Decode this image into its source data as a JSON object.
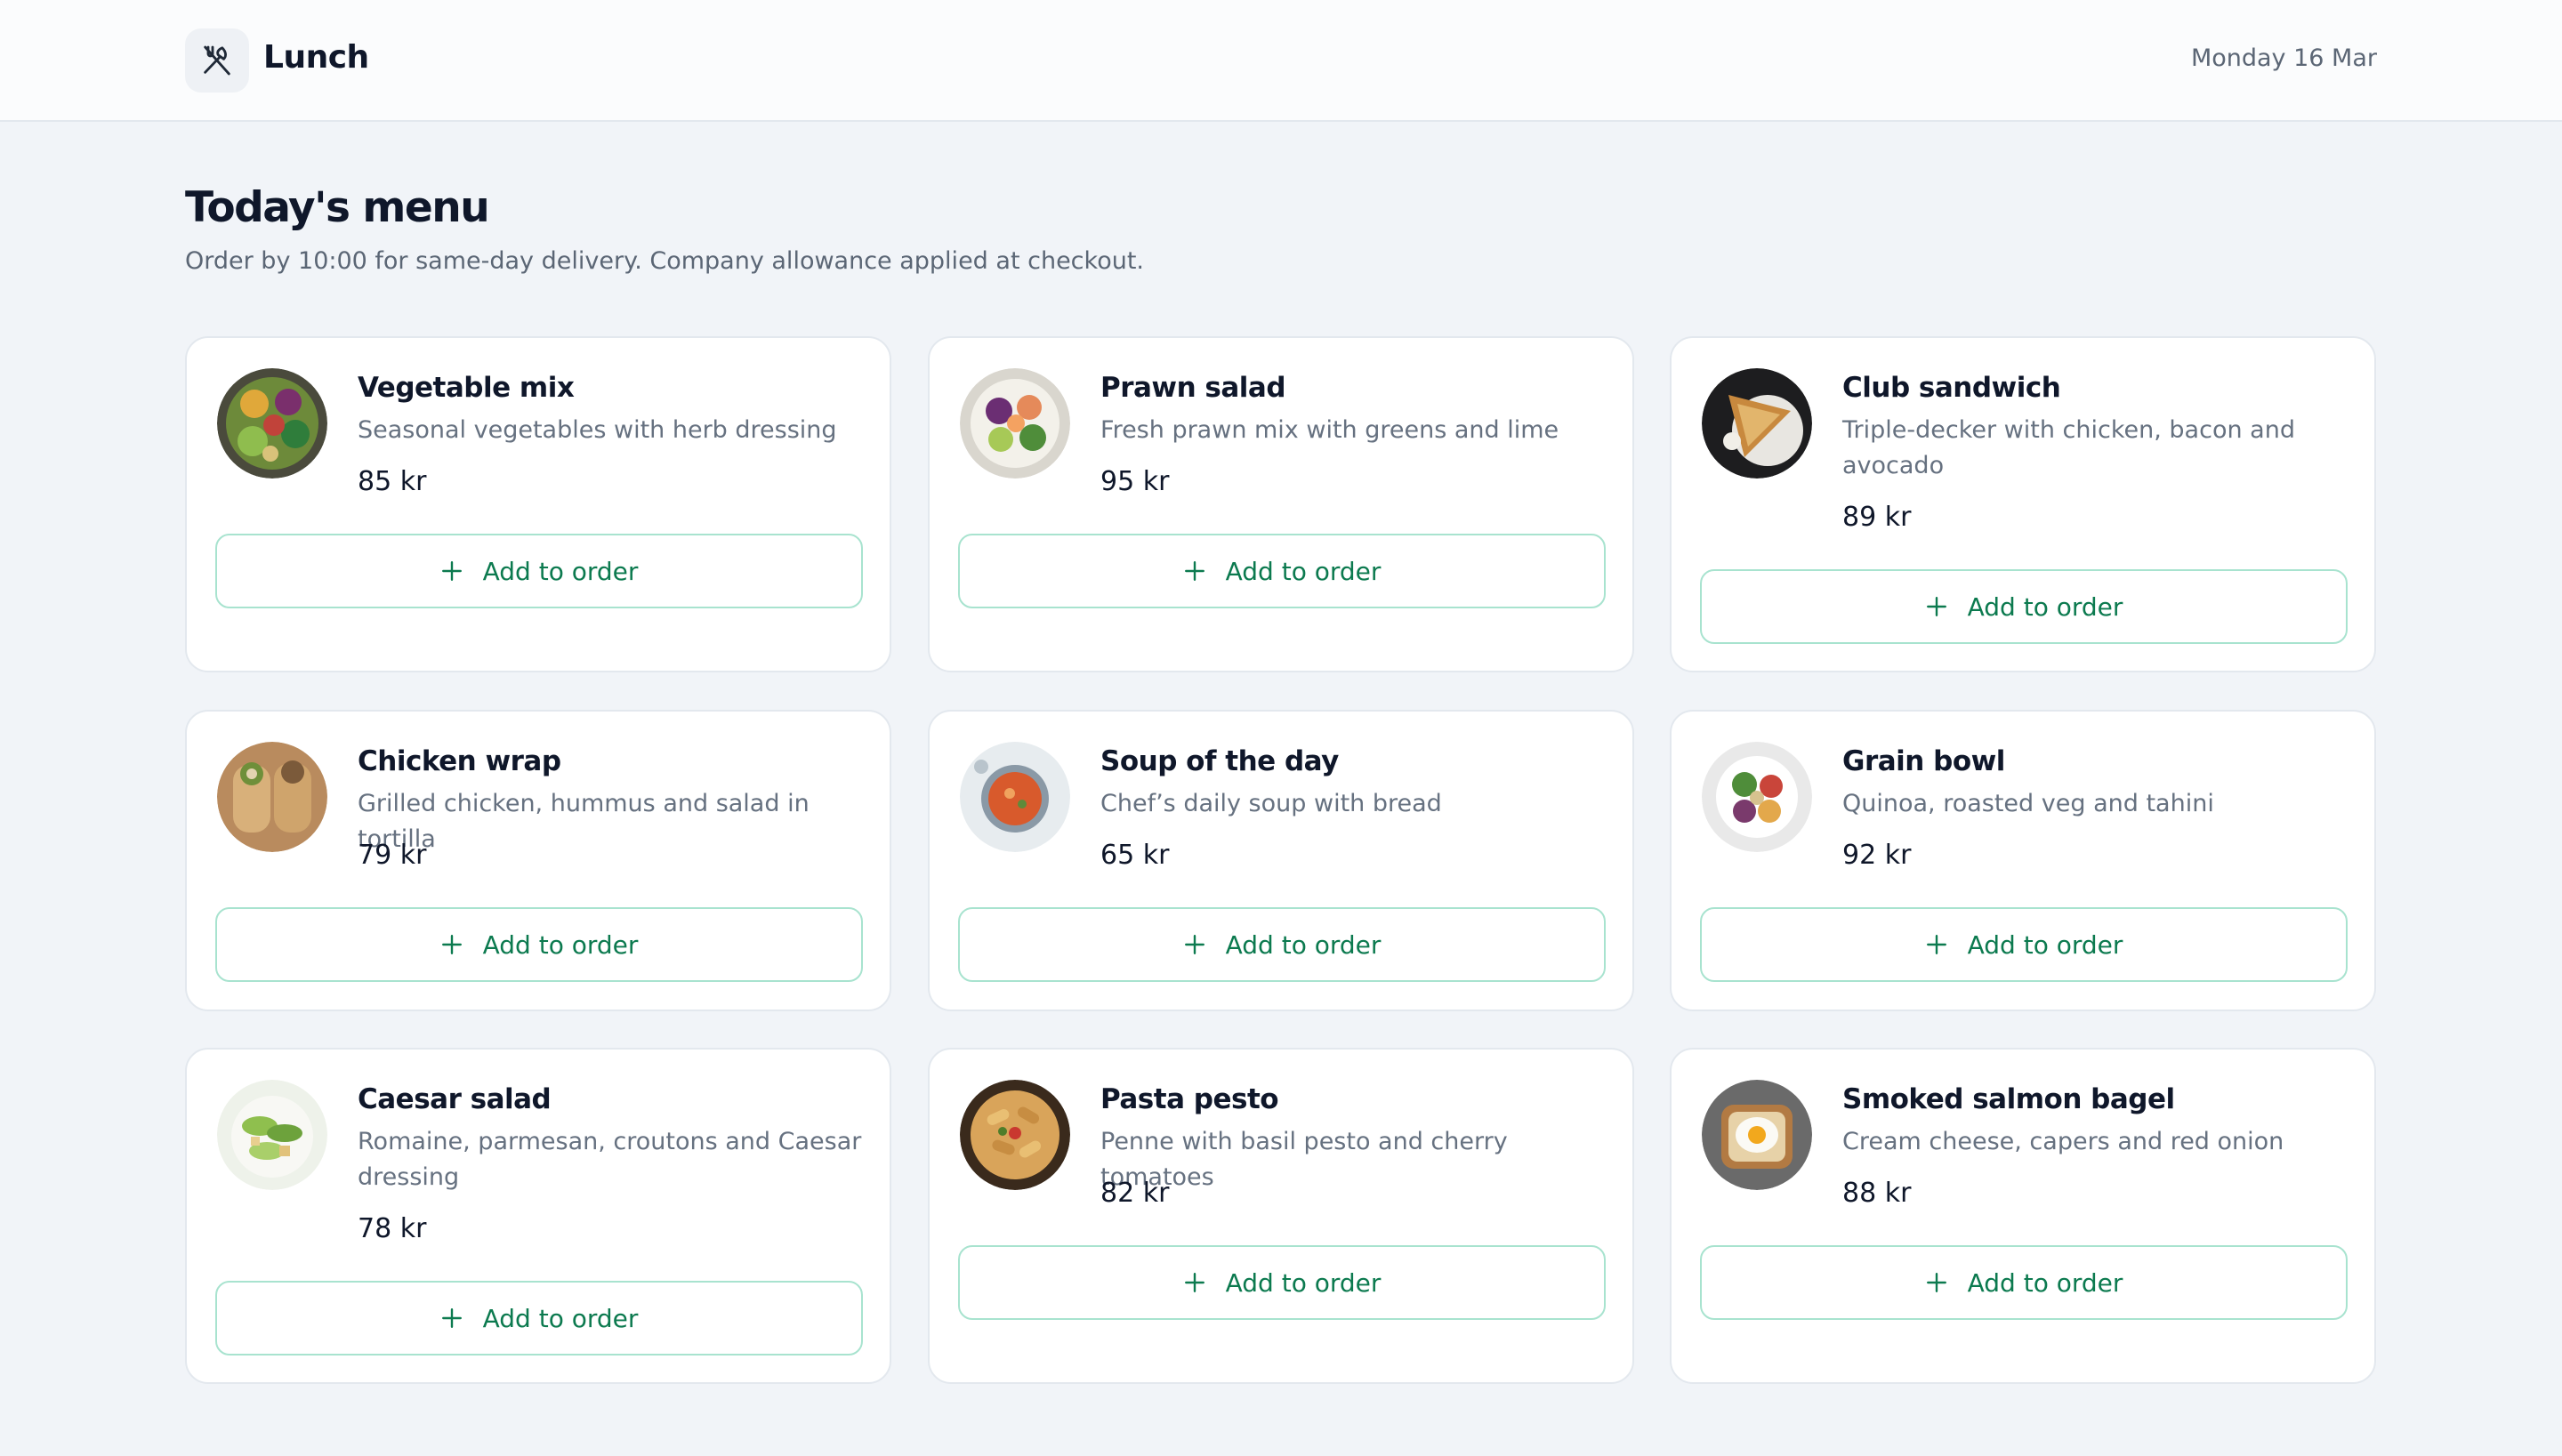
{
  "app": {
    "title": "Lunch",
    "date": "Monday 16 Mar",
    "icon": "utensils-crossed-icon"
  },
  "page": {
    "title": "Today's menu",
    "subtitle": "Order by 10:00 for same-day delivery. Company allowance applied at checkout."
  },
  "colors": {
    "accent": "#0c7a4f",
    "button_border": "#a8e3cf",
    "background": "#f1f4f8",
    "card": "#ffffff"
  },
  "add_label": "Add to order",
  "items": [
    {
      "name": "Vegetable mix",
      "description": "Seasonal vegetables with herb dressing",
      "price": "85 kr",
      "image": "vegetable-mix-photo"
    },
    {
      "name": "Prawn salad",
      "description": "Fresh prawn mix with greens and lime",
      "price": "95 kr",
      "image": "prawn-salad-photo"
    },
    {
      "name": "Club sandwich",
      "description": "Triple-decker with chicken, bacon and avocado",
      "price": "89 kr",
      "image": "club-sandwich-photo"
    },
    {
      "name": "Chicken wrap",
      "description": "Grilled chicken, hummus and salad in tortilla",
      "price": "79 kr",
      "image": "chicken-wrap-photo"
    },
    {
      "name": "Soup of the day",
      "description": "Chef’s daily soup with bread",
      "price": "65 kr",
      "image": "soup-photo"
    },
    {
      "name": "Grain bowl",
      "description": "Quinoa, roasted veg and tahini",
      "price": "92 kr",
      "image": "grain-bowl-photo"
    },
    {
      "name": "Caesar salad",
      "description": "Romaine, parmesan, croutons and Caesar dressing",
      "price": "78 kr",
      "image": "caesar-salad-photo"
    },
    {
      "name": "Pasta pesto",
      "description": "Penne with basil pesto and cherry tomatoes",
      "price": "82 kr",
      "image": "pasta-pesto-photo"
    },
    {
      "name": "Smoked salmon bagel",
      "description": "Cream cheese, capers and red onion",
      "price": "88 kr",
      "image": "salmon-bagel-photo"
    }
  ]
}
